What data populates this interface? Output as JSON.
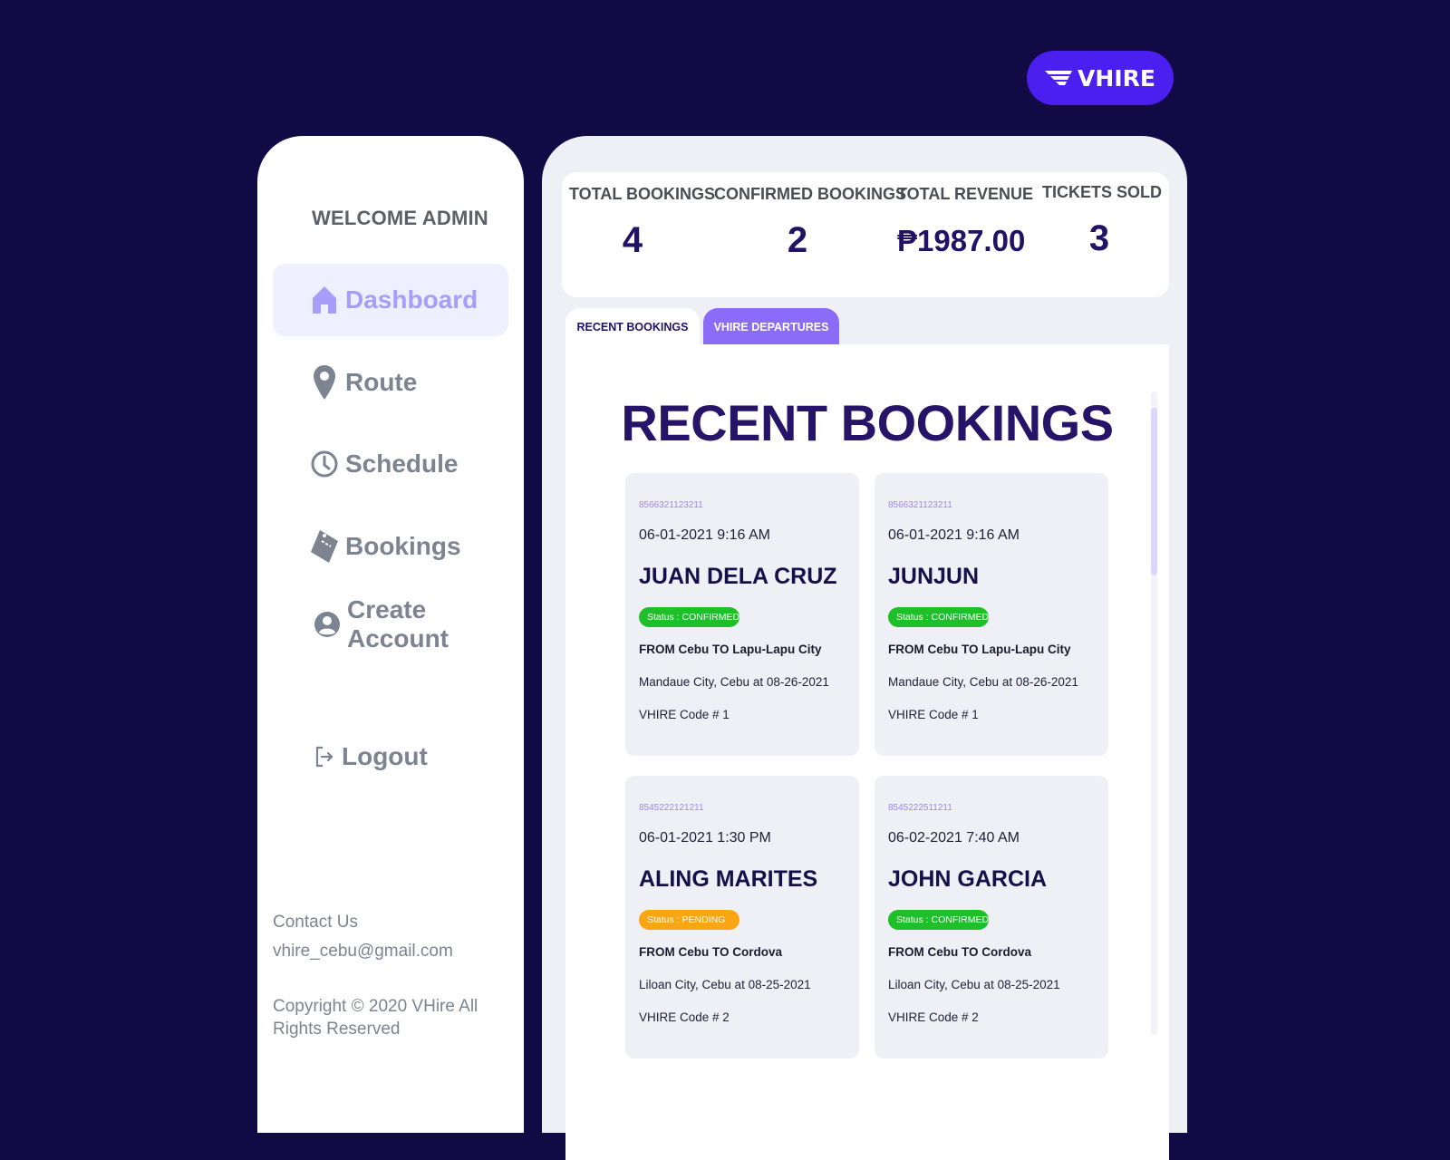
{
  "brand": {
    "logo_text": "VHIRE",
    "colors": {
      "background": "#110a45",
      "logo_pill": "#4a1ff0",
      "accent": "#8b6cf8",
      "active_nav": "#a99dfa",
      "confirmed": "#1fbf2a",
      "pending": "#f9a514"
    }
  },
  "sidebar": {
    "welcome": "WELCOME ADMIN",
    "items": [
      {
        "label": "Dashboard",
        "icon": "home-icon",
        "active": true
      },
      {
        "label": "Route",
        "icon": "map-pin-icon",
        "active": false
      },
      {
        "label": "Schedule",
        "icon": "clock-icon",
        "active": false
      },
      {
        "label": "Bookings",
        "icon": "ticket-icon",
        "active": false
      },
      {
        "label": "Create Account",
        "icon": "user-circle-icon",
        "active": false
      }
    ],
    "logout": {
      "label": "Logout",
      "icon": "logout-icon"
    },
    "contact_label": "Contact Us",
    "contact_email": "vhire_cebu@gmail.com",
    "copyright": "Copyright © 2020 VHire All Rights Reserved"
  },
  "stats": [
    {
      "label": "TOTAL BOOKINGS",
      "value": "4"
    },
    {
      "label": "CONFIRMED BOOKINGS",
      "value": "2"
    },
    {
      "label": "TOTAL REVENUE",
      "value": "₱1987.00"
    },
    {
      "label": "TICKETS SOLD",
      "value": "3"
    }
  ],
  "tabs": [
    {
      "label": "RECENT BOOKINGS",
      "active": true
    },
    {
      "label": "VHIRE DEPARTURES",
      "active": false
    }
  ],
  "content": {
    "title": "RECENT BOOKINGS"
  },
  "bookings": [
    {
      "id": "8566321123211",
      "datetime": "06-01-2021  9:16 AM",
      "name": "JUAN DELA CRUZ",
      "status": "Status : CONFIRMED",
      "status_type": "confirmed",
      "route": "FROM Cebu TO Lapu-Lapu City",
      "location": "Mandaue City, Cebu at 08-26-2021",
      "code": "VHIRE Code # 1"
    },
    {
      "id": "8566321123211",
      "datetime": "06-01-2021  9:16 AM",
      "name": "JUNJUN",
      "status": "Status : CONFIRMED",
      "status_type": "confirmed",
      "route": "FROM Cebu TO Lapu-Lapu City",
      "location": "Mandaue City, Cebu at 08-26-2021",
      "code": "VHIRE Code # 1"
    },
    {
      "id": "8545222121211",
      "datetime": "06-01-2021  1:30 PM",
      "name": "ALING MARITES",
      "status": "Status : PENDING",
      "status_type": "pending",
      "route": "FROM Cebu TO Cordova",
      "location": "Liloan City, Cebu at 08-25-2021",
      "code": "VHIRE Code # 2"
    },
    {
      "id": "8545222511211",
      "datetime": "06-02-2021  7:40 AM",
      "name": "JOHN GARCIA",
      "status": "Status : CONFIRMED",
      "status_type": "confirmed",
      "route": "FROM Cebu TO Cordova",
      "location": "Liloan City, Cebu at 08-25-2021",
      "code": "VHIRE Code # 2"
    }
  ]
}
